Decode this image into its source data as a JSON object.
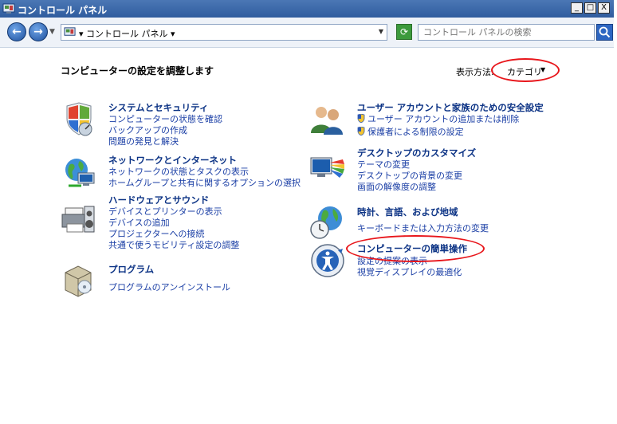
{
  "window": {
    "title": "コントロール パネル",
    "buttons": {
      "minimize": "_",
      "maximize": "□",
      "close": "X"
    }
  },
  "address": {
    "breadcrumb": "▾ コントロール パネル ▾",
    "search_placeholder": "コントロール パネルの検索"
  },
  "main": {
    "heading": "コンピューターの設定を調整します",
    "view_label": "表示方法:",
    "view_value": "カテゴリ",
    "categories": [
      {
        "title": "システムとセキュリティ",
        "links": [
          "コンピューターの状態を確認",
          "バックアップの作成",
          "問題の発見と解決"
        ]
      },
      {
        "title": "ネットワークとインターネット",
        "links": [
          "ネットワークの状態とタスクの表示",
          "ホームグループと共有に関するオプションの選択"
        ]
      },
      {
        "title": "ハードウェアとサウンド",
        "links": [
          "デバイスとプリンターの表示",
          "デバイスの追加",
          "プロジェクターへの接続",
          "共通で使うモビリティ設定の調整"
        ]
      },
      {
        "title": "プログラム",
        "links": [
          "プログラムのアンインストール"
        ]
      },
      {
        "title": "ユーザー アカウントと家族のための安全設定",
        "links": [
          "ユーザー アカウントの追加または削除",
          "保護者による制限の設定"
        ]
      },
      {
        "title": "デスクトップのカスタマイズ",
        "links": [
          "テーマの変更",
          "デスクトップの背景の変更",
          "画面の解像度の調整"
        ]
      },
      {
        "title": "時計、言語、および地域",
        "links": [
          "キーボードまたは入力方法の変更"
        ]
      },
      {
        "title": "コンピューターの簡単操作",
        "links": [
          "設定の提案の表示",
          "視覚ディスプレイの最適化"
        ]
      }
    ]
  },
  "colors": {
    "title_bar": "#2f5c9e",
    "link": "#1a3ea5",
    "category_title": "#0c3385",
    "annotation": "#e8161b"
  },
  "icons": [
    "control-panel-icon",
    "back-arrow-icon",
    "forward-arrow-icon",
    "refresh-icon",
    "search-icon",
    "shield-icon",
    "network-globe-icon",
    "printer-icon",
    "program-box-icon",
    "users-icon",
    "monitor-palette-icon",
    "globe-clock-icon",
    "ease-of-access-icon"
  ]
}
